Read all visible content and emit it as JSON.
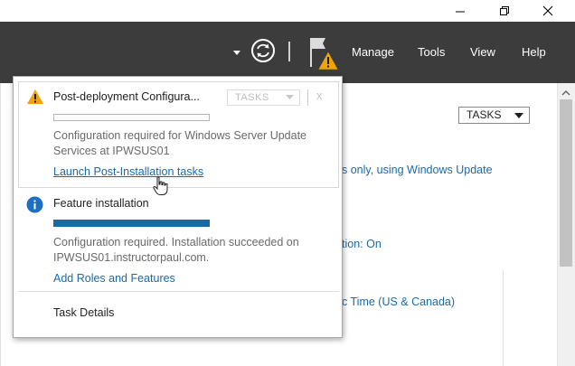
{
  "window_controls": {
    "minimize": "minimize-icon",
    "maximize": "restore-icon",
    "close": "close-icon"
  },
  "commandbar": {
    "menu": [
      "Manage",
      "Tools",
      "View",
      "Help"
    ],
    "icons": [
      "caret-down-icon",
      "refresh-icon",
      "flag-icon",
      "warning-icon"
    ],
    "background_color": "#3c3c3c"
  },
  "background": {
    "tasks_label": "TASKS",
    "text_fragments": [
      "s only, using Windows Update",
      "tion: On",
      "c Time (US & Canada)"
    ]
  },
  "notifications": [
    {
      "icon": "warning-icon",
      "title": "Post-deployment Configura...",
      "tasks_label": "TASKS",
      "close_glyph": "x",
      "progress": 0,
      "message": "Configuration required for Windows Server Update Services at IPWSUS01",
      "link": "Launch Post-Installation tasks"
    },
    {
      "icon": "info-icon",
      "title": "Feature installation",
      "progress": 1,
      "message": "Configuration required. Installation succeeded on IPWSUS01.instructorpaul.com.",
      "link": "Add Roles and Features"
    }
  ],
  "footer": {
    "task_details": "Task Details"
  },
  "colors": {
    "accent": "#1a6aa8",
    "warning": "#f0a30a",
    "info": "#1e6fc2"
  }
}
